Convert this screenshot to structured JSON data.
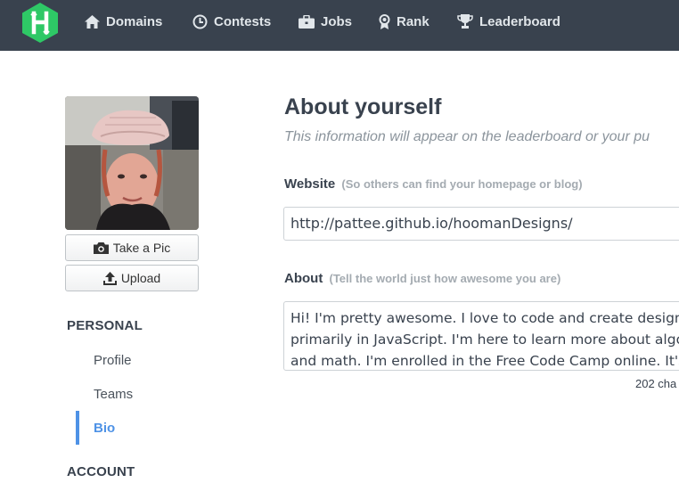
{
  "nav": {
    "items": [
      {
        "label": "Domains",
        "icon": "home-icon"
      },
      {
        "label": "Contests",
        "icon": "clock-icon"
      },
      {
        "label": "Jobs",
        "icon": "briefcase-icon"
      },
      {
        "label": "Rank",
        "icon": "medal-icon"
      },
      {
        "label": "Leaderboard",
        "icon": "trophy-icon"
      }
    ],
    "logo_letter": "H",
    "colors": {
      "bar": "#39424e",
      "logo": "#2ec866"
    }
  },
  "sidebar": {
    "take_pic_label": "Take a Pic",
    "upload_label": "Upload",
    "personal_title": "PERSONAL",
    "links": [
      {
        "label": "Profile"
      },
      {
        "label": "Teams"
      },
      {
        "label": "Bio",
        "active": true
      }
    ],
    "account_title": "ACCOUNT",
    "accent": "#4e92e6"
  },
  "main": {
    "title": "About yourself",
    "subtitle": "This information will appear on the leaderboard or your pu",
    "website": {
      "label": "Website",
      "hint": "(So others can find your homepage or blog)",
      "value": "http://pattee.github.io/hoomanDesigns/"
    },
    "about": {
      "label": "About",
      "hint": "(Tell the world just how awesome you are)",
      "lines": [
        "Hi! I'm pretty awesome. I love to code and create designs",
        "primarily in JavaScript. I'm here to learn more about algo",
        "and math. I'm enrolled in the Free Code Camp online. It's"
      ]
    },
    "char_count": "202 cha"
  }
}
